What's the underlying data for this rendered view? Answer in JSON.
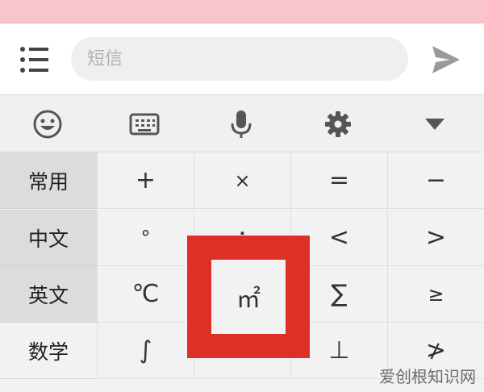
{
  "compose": {
    "placeholder": "短信"
  },
  "toolbar": {
    "icons": [
      "emoji-icon",
      "keyboard-icon",
      "microphone-icon",
      "gear-icon",
      "triangle-down-icon"
    ]
  },
  "categories": [
    {
      "label": "常用",
      "active": false
    },
    {
      "label": "中文",
      "active": false
    },
    {
      "label": "英文",
      "active": false
    },
    {
      "label": "数学",
      "active": true
    }
  ],
  "keys": [
    [
      "+",
      "×",
      "=",
      "−"
    ],
    [
      "°",
      "÷",
      "<",
      ">"
    ],
    [
      "℃",
      "㎡",
      "∑",
      "≥"
    ],
    [
      "∫",
      "∞",
      "⊥",
      "≯"
    ]
  ],
  "watermark": "爱创根知识网",
  "colors": {
    "accent_pink": "#f8c5cf",
    "highlight_red": "#dd3128"
  }
}
